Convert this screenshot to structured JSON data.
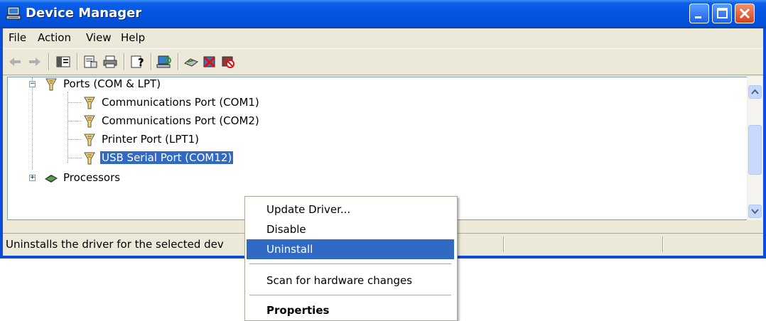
{
  "window": {
    "title": "Device Manager"
  },
  "menubar": {
    "items": [
      "File",
      "Action",
      "View",
      "Help"
    ]
  },
  "tree": {
    "items": [
      {
        "label": "Ports (COM & LPT)"
      },
      {
        "label": "Communications Port (COM1)"
      },
      {
        "label": "Communications Port (COM2)"
      },
      {
        "label": "Printer Port (LPT1)"
      },
      {
        "label": "USB Serial Port (COM12)"
      },
      {
        "label": "Processors"
      }
    ]
  },
  "status": {
    "text": "Uninstalls the driver for the selected dev"
  },
  "context_menu": {
    "items": [
      {
        "label": "Update Driver..."
      },
      {
        "label": "Disable"
      },
      {
        "label": "Uninstall"
      },
      {
        "label": "Scan for hardware changes"
      },
      {
        "label": "Properties"
      }
    ]
  },
  "colors": {
    "titlebar": "#0554e0",
    "selection": "#316ac5",
    "face": "#ece9d8"
  },
  "icons": [
    "computer-icon",
    "back-icon",
    "forward-icon",
    "show-hide-console-tree-icon",
    "properties-icon",
    "print-icon",
    "help-icon",
    "scan-hardware-icon",
    "update-driver-icon",
    "uninstall-icon",
    "disable-icon",
    "port-icon",
    "processor-icon"
  ]
}
